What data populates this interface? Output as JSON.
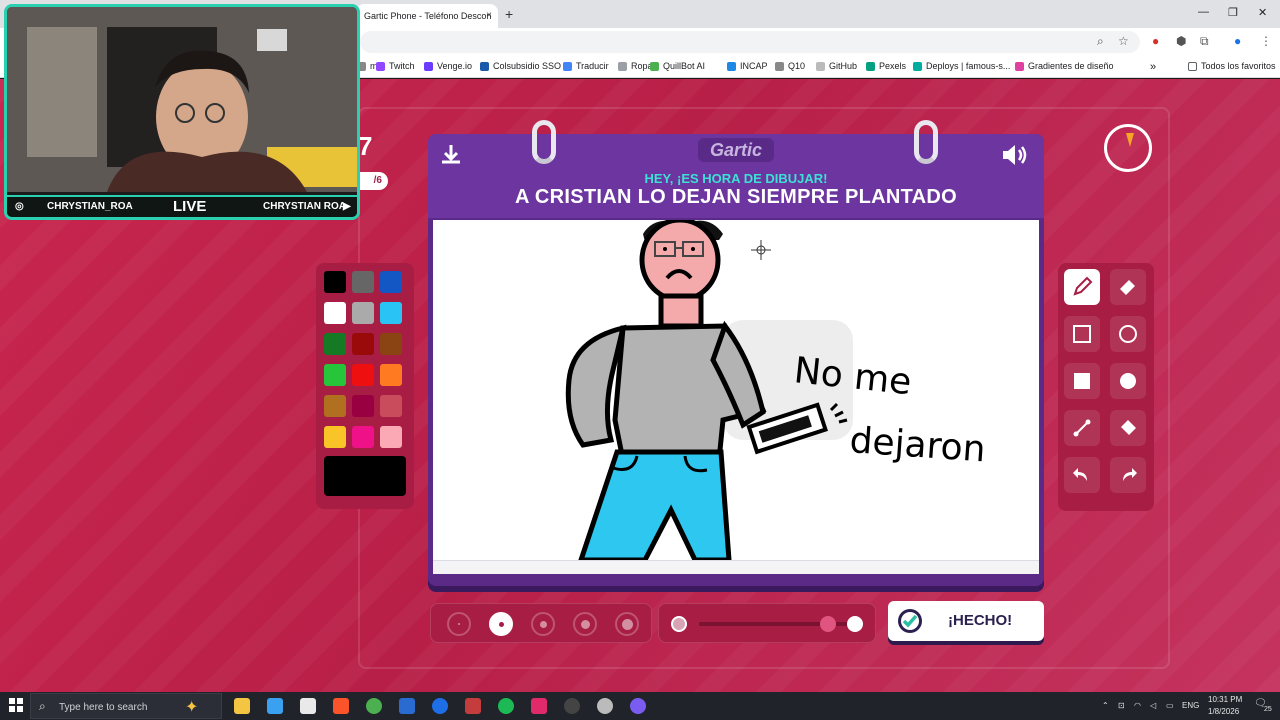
{
  "browser": {
    "tab_title": "Gartic Phone - Teléfono Descon",
    "tab_close": "×",
    "new_tab": "+",
    "bookmarks": [
      {
        "label": "m",
        "color": "#888888"
      },
      {
        "label": "Twitch",
        "color": "#9146ff"
      },
      {
        "label": "Venge.io",
        "color": "#6b3cff"
      },
      {
        "label": "Colsubsidio SSO",
        "color": "#1a5aa8"
      },
      {
        "label": "Traducir",
        "color": "#4285f4"
      },
      {
        "label": "Ropa",
        "color": "#9aa0a6"
      },
      {
        "label": "QuillBot AI",
        "color": "#4caf50"
      },
      {
        "label": "INCAP",
        "color": "#1e88e5"
      },
      {
        "label": "Q10",
        "color": "#888888"
      },
      {
        "label": "GitHub",
        "color": "#bbbbbb"
      },
      {
        "label": "Pexels",
        "color": "#05a081"
      },
      {
        "label": "Deploys | famous-s...",
        "color": "#00ad9f"
      },
      {
        "label": "Gradientes de diseño",
        "color": "#e040a0"
      }
    ],
    "all_bookmarks": "Todos los favoritos",
    "more_bookmarks": "»"
  },
  "game": {
    "round_number": "7",
    "round_total": "/6",
    "logo": "Gartic",
    "subtitle": "HEY, ¡ES HORA DE DIBUJAR!",
    "prompt": "A CRISTIAN LO DEJAN SIEMPRE PLANTADO",
    "timer_fraction": 0.06,
    "done_label": "¡HECHO!",
    "palette": [
      "#000000",
      "#666666",
      "#1357c4",
      "#ffffff",
      "#aaaaaa",
      "#2ac3f5",
      "#147a23",
      "#9a0a0a",
      "#8a4413",
      "#26c53a",
      "#ee1010",
      "#ff7a20",
      "#b0701f",
      "#990042",
      "#c94c5c",
      "#f8c428",
      "#ee1188",
      "#fbaab5"
    ],
    "current_color": "#000000",
    "tools": [
      "pencil-icon",
      "eraser-icon",
      "rectangle-outline-icon",
      "circle-outline-icon",
      "rectangle-fill-icon",
      "circle-fill-icon",
      "line-icon",
      "bucket-icon",
      "undo-icon",
      "redo-icon"
    ],
    "brush_sizes_selected_index": 1,
    "opacity_level": 0.86
  },
  "drawing": {
    "handwritten_line1": "No me",
    "handwritten_line2": "dejaron"
  },
  "webcam": {
    "left_handle": "CHRYSTIAN_ROA",
    "live": "LIVE",
    "right_handle": "CHRYSTIAN ROA"
  },
  "taskbar": {
    "search_placeholder": "Type here to search",
    "lang": "ENG",
    "time": "10:31 PM",
    "date": "1/8/2026",
    "notifications": "25"
  }
}
